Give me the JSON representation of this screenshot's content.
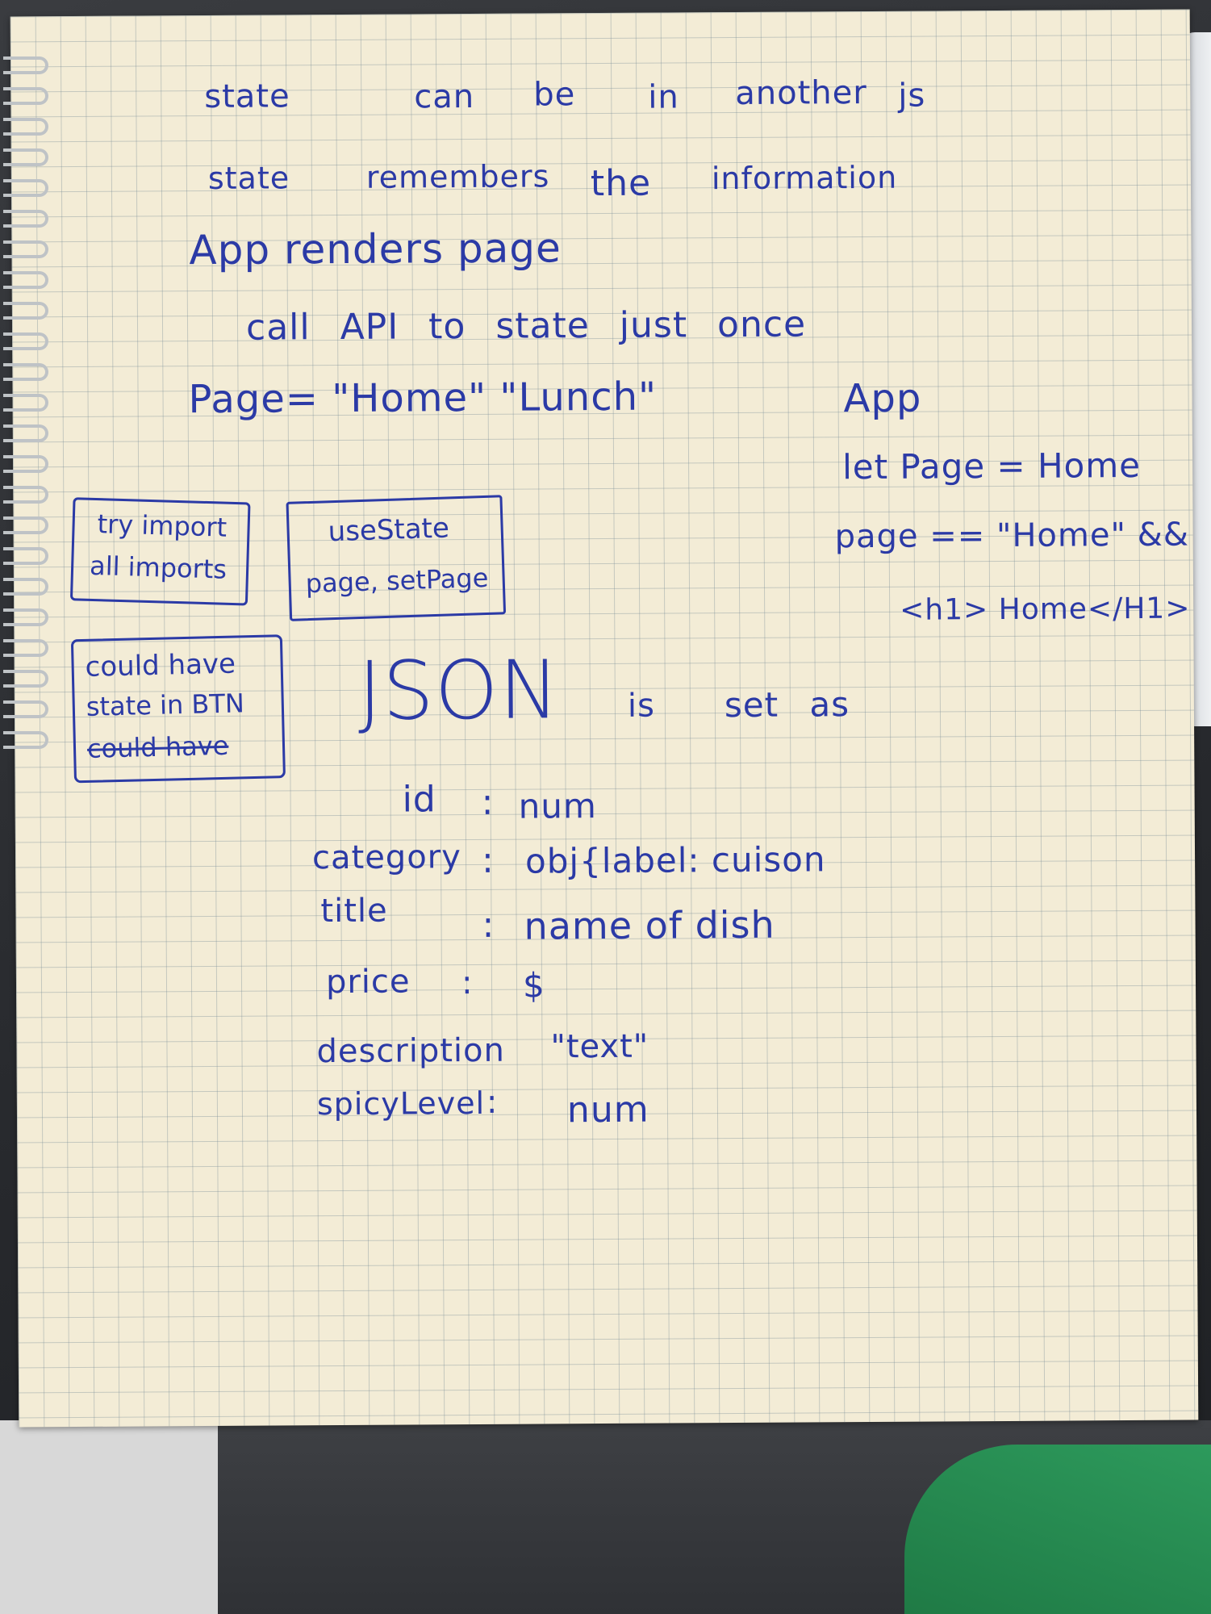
{
  "notes": {
    "line1": [
      "state",
      "can",
      "be",
      "in",
      "another",
      "js"
    ],
    "line2": [
      "state",
      "remembers",
      "the",
      "information"
    ],
    "line3": "App renders page",
    "line4": "call API to state just once",
    "line5": "Page= \"Home\"  \"Lunch\"",
    "app_block": {
      "title": "App",
      "let": "let Page = Home",
      "condition": "page == \"Home\" &&",
      "heading": "<h1> Home</H1>"
    },
    "box_import": [
      "try import",
      "all imports"
    ],
    "box_usestate": [
      "useState",
      "page, setPage"
    ],
    "box_btn": [
      "could have",
      "state in BTN",
      "could have"
    ],
    "json_heading": [
      "JSON",
      "is",
      "set as"
    ],
    "schema": [
      {
        "key": "id",
        "value": "num"
      },
      {
        "key": "category",
        "value": "obj{label: cuison"
      },
      {
        "key": "title",
        "value": "name of dish"
      },
      {
        "key": "price",
        "value": "$"
      },
      {
        "key": "description",
        "value": "\"text\""
      },
      {
        "key": "spicyLevel",
        "value": "num"
      }
    ]
  },
  "colors": {
    "ink": "#2b3aa6",
    "paper": "#f3ecd6",
    "grid": "#8c9aa0"
  }
}
